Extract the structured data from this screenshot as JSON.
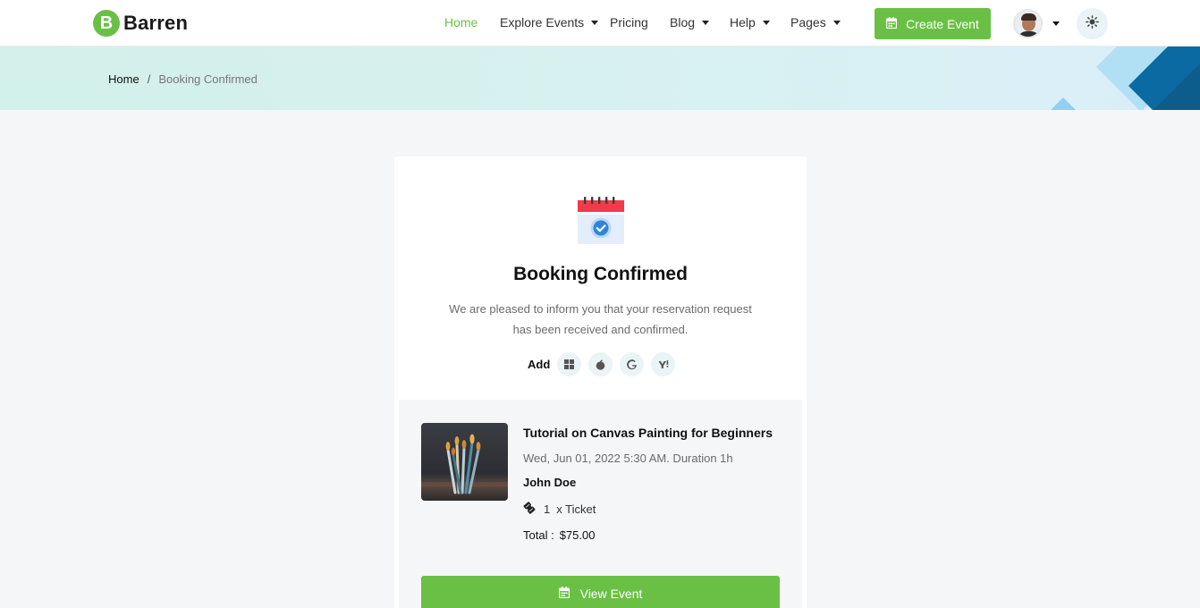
{
  "brand": {
    "mark": "B",
    "name": "Barren"
  },
  "nav": [
    {
      "label": "Home",
      "active": true
    },
    {
      "label": "Explore Events",
      "dropdown": true
    },
    {
      "label": "Pricing"
    },
    {
      "label": "Blog",
      "dropdown": true
    },
    {
      "label": "Help",
      "dropdown": true
    },
    {
      "label": "Pages",
      "dropdown": true
    }
  ],
  "header": {
    "create_label": "Create Event"
  },
  "breadcrumb": {
    "home": "Home",
    "separator": "/",
    "current": "Booking Confirmed"
  },
  "confirmation": {
    "title": "Booking Confirmed",
    "message": "We are pleased to inform you that your reservation request has been received and confirmed.",
    "add_label": "Add",
    "calendar_icons": [
      "windows-icon",
      "apple-icon",
      "google-icon",
      "yahoo-icon"
    ]
  },
  "booking": {
    "event_title": "Tutorial on Canvas Painting for Beginners",
    "datetime": "Wed, Jun 01, 2022 5:30 AM. Duration 1h",
    "attendee": "John Doe",
    "ticket_qty": "1",
    "ticket_label": "x Ticket",
    "total_label": "Total :",
    "total_amount": "$75.00",
    "view_label": "View Event"
  },
  "colors": {
    "accent": "#6ac045",
    "icon_bg": "#eaf3f6",
    "banner_dark": "#0a6aa1",
    "banner_light": "#93cfee"
  }
}
